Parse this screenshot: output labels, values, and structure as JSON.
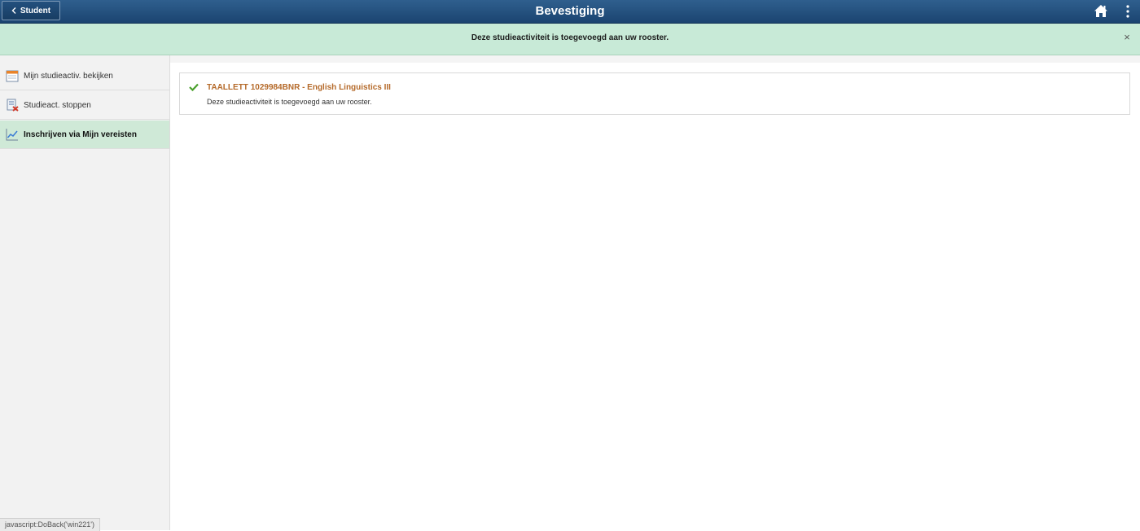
{
  "header": {
    "back_label": "Student",
    "title": "Bevestiging",
    "home_icon": "home-icon",
    "menu_icon": "more-vertical-icon",
    "colors": {
      "bar": "#1f4a78"
    }
  },
  "banner": {
    "message": "Deze studieactiviteit is toegevoegd aan uw rooster.",
    "close_label": "×",
    "color": "#c8ead7"
  },
  "sidebar": {
    "items": [
      {
        "label": "Mijn studieactiv. bekijken",
        "icon": "calendar-icon",
        "active": false
      },
      {
        "label": "Studieact. stoppen",
        "icon": "drop-class-icon",
        "active": false
      },
      {
        "label": "Inschrijven via Mijn vereisten",
        "icon": "chart-line-icon",
        "active": true
      }
    ],
    "active_color": "#cfe9d7"
  },
  "result": {
    "course": "TAALLETT 1029984BNR - English Linguistics III",
    "status": "Deze studieactiviteit is toegevoegd aan uw rooster.",
    "title_color": "#b56a2a",
    "check_color": "#4aa02c"
  },
  "statusbar": {
    "url": "javascript:DoBack('win221')"
  }
}
